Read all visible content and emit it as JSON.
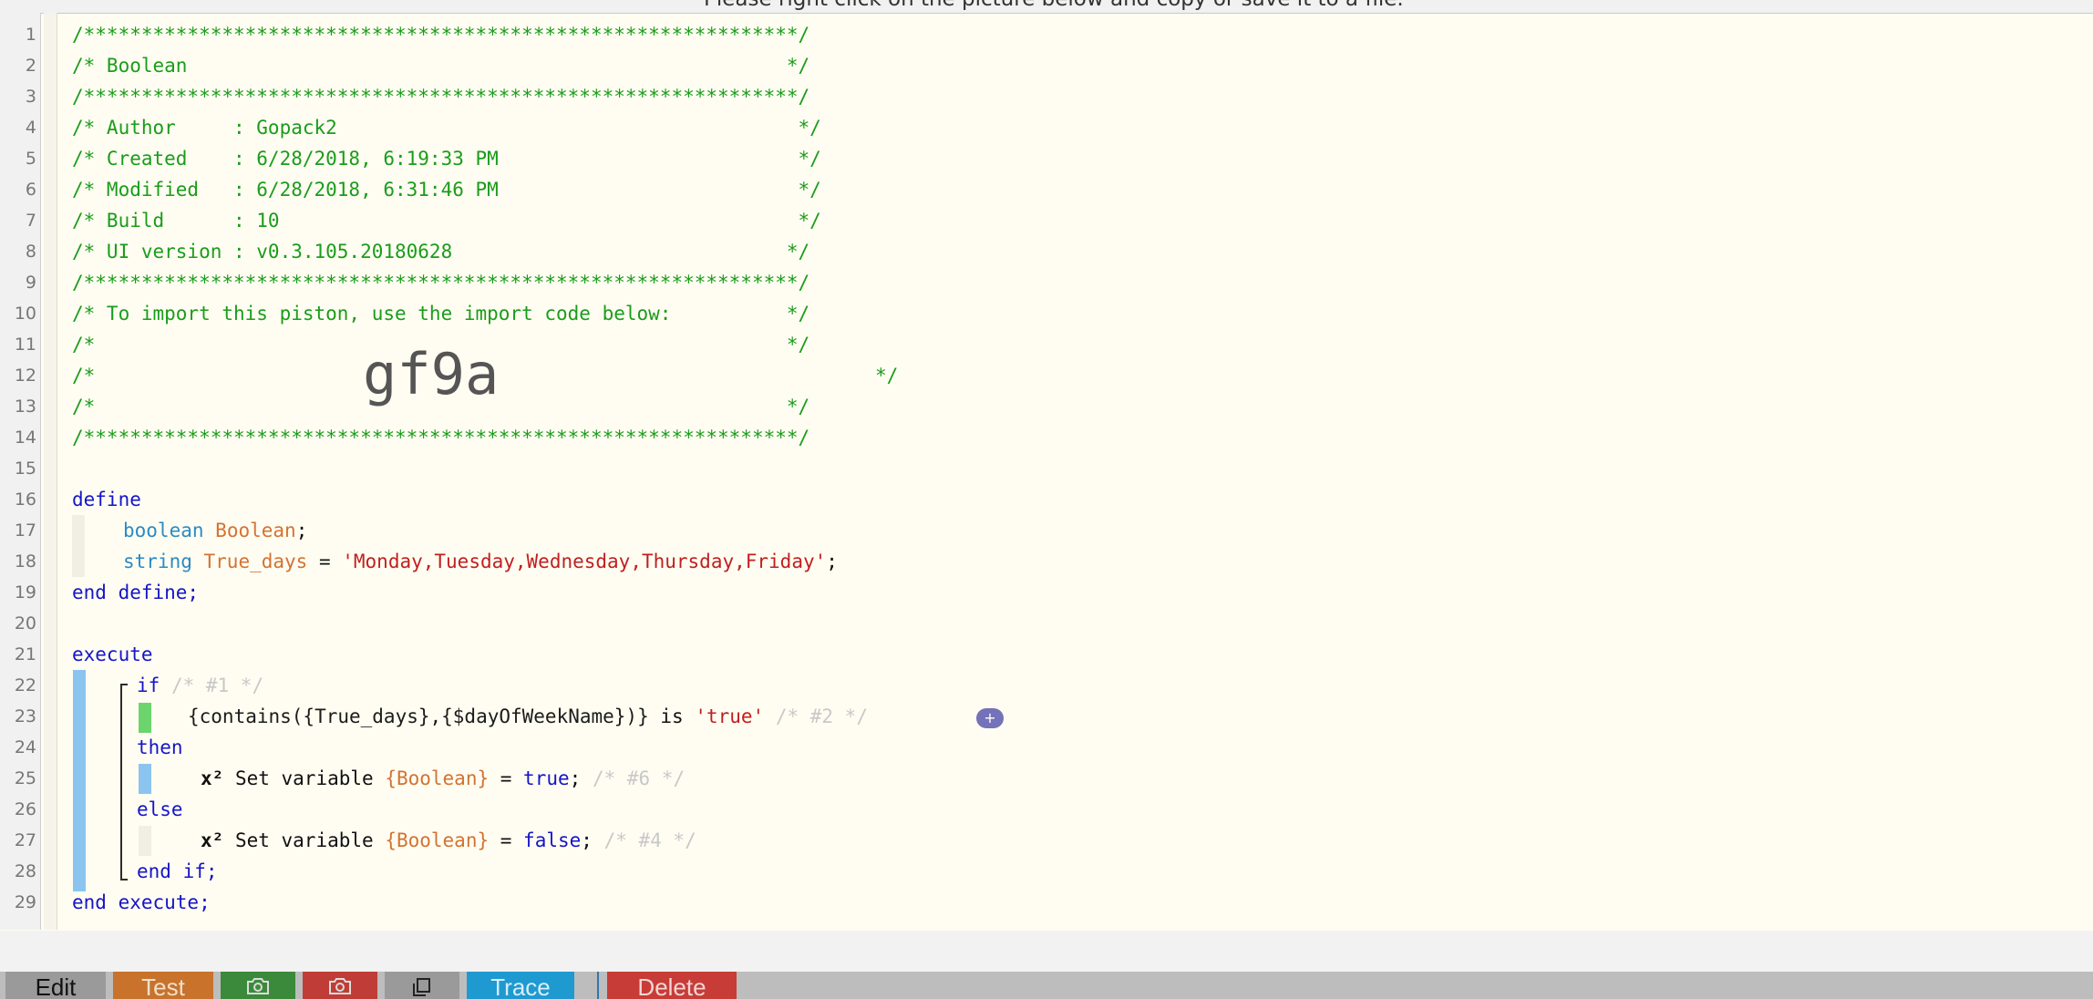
{
  "window": {
    "instruction": "Please right click on the picture below and copy or save it to a file."
  },
  "editor": {
    "line_numbers": [
      "1",
      "2",
      "3",
      "4",
      "5",
      "6",
      "7",
      "8",
      "9",
      "10",
      "11",
      "12",
      "13",
      "14",
      "15",
      "16",
      "17",
      "18",
      "19",
      "20",
      "21",
      "22",
      "23",
      "24",
      "25",
      "26",
      "27",
      "28",
      "29"
    ],
    "header": {
      "border": "/**************************************************************/",
      "title": "/* Boolean                                                    */",
      "author": "/* Author     : Gopack2                                        */",
      "created": "/* Created    : 6/28/2018, 6:19:33 PM                          */",
      "modified": "/* Modified   : 6/28/2018, 6:31:46 PM                          */",
      "build": "/* Build      : 10                                             */",
      "ui_version": "/* UI version : v0.3.105.20180628                             */",
      "import_note": "/* To import this piston, use the import code below:          */",
      "blank_comment": "/*                                                            */",
      "open_comment": "/*",
      "close_comment": "*/",
      "import_code": "gf9a"
    },
    "define_block": {
      "define_kw": "define",
      "var1_type": "boolean",
      "var1_name": "Boolean",
      "var1_end": ";",
      "var2_type": "string",
      "var2_name": "True_days",
      "var2_eq": " = ",
      "var2_value": "'Monday,Tuesday,Wednesday,Thursday,Friday'",
      "var2_end": ";",
      "end_define": "end define;"
    },
    "execute_block": {
      "execute_kw": "execute",
      "if_kw": "if",
      "if_comment": "/* #1 */",
      "condition_expr": "{contains({True_days},{$dayOfWeekName})}",
      "condition_op": " is ",
      "condition_value": "'true'",
      "condition_comment": "/* #2 */",
      "add_condition": "+",
      "then_kw": "then",
      "x_icon": "x²",
      "then_action_text": " Set variable ",
      "then_action_var": "{Boolean}",
      "then_action_eq": " = ",
      "then_action_value": "true",
      "then_action_end": ";",
      "then_comment": "/* #6 */",
      "else_kw": "else",
      "else_action_text": " Set variable ",
      "else_action_var": "{Boolean}",
      "else_action_eq": " = ",
      "else_action_value": "false",
      "else_action_end": ";",
      "else_comment": "/* #4 */",
      "end_if": "end if;",
      "end_execute": "end execute;"
    }
  },
  "toolbar": {
    "edit_label": "Edit",
    "test_label": "Test",
    "camera_icon": "camera-icon",
    "copy_icon": "duplicate-icon",
    "trace_label": "Trace",
    "delete_label": "Delete"
  },
  "colors": {
    "comment": "#1a9c1a",
    "keyword": "#1515c8",
    "type": "#2b8ac3",
    "variable": "#d27332",
    "string": "#c02020",
    "edit_bg": "#9a9a9a",
    "test_bg": "#c8722c",
    "green_snap_bg": "#3b8a3b",
    "red_snap_bg": "#bf3d36",
    "dup_bg": "#9a9a9a",
    "trace_bg": "#1e9ad0",
    "delete_bg": "#c73c37"
  }
}
